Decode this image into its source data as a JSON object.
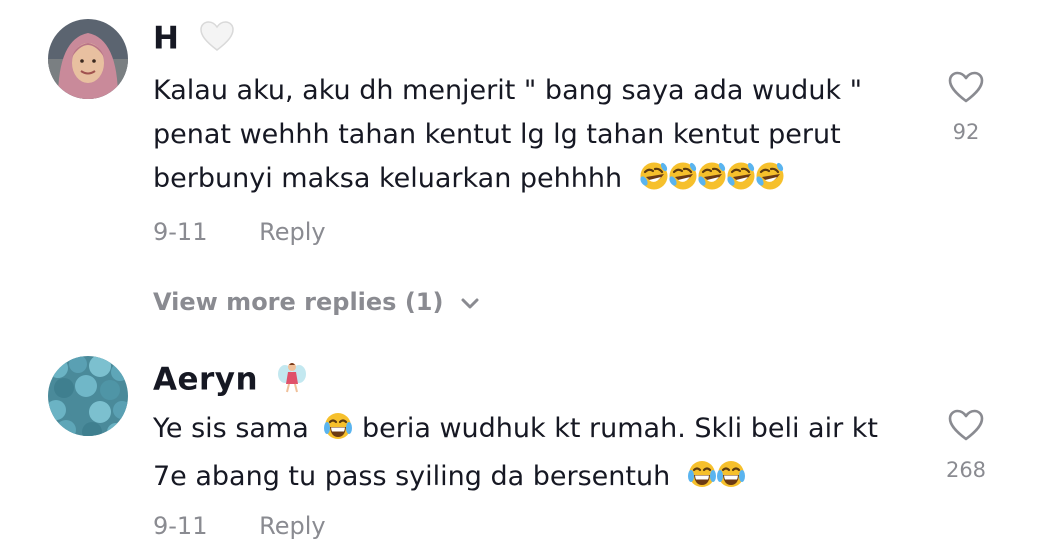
{
  "comments": [
    {
      "username": "H",
      "username_emoji": "white-heart-icon",
      "text_lines": [
        "Kalau aku, aku dh menjerit \" bang saya ada wuduk \"",
        "penat wehhh tahan kentut lg lg tahan kentut perut",
        "berbunyi maksa keluarkan pehhhh"
      ],
      "date": "9-11",
      "reply_label": "Reply",
      "like_count": "92",
      "view_more_label": "View more replies (1)"
    },
    {
      "username": "Aeryn",
      "username_emoji": "fairy-icon",
      "text_lines": [
        "Ye sis sama",
        "beria wudhuk kt rumah. Skli beli air kt",
        "7e abang tu pass syiling da bersentuh"
      ],
      "date": "9-11",
      "reply_label": "Reply",
      "like_count": "268"
    }
  ],
  "icons": {
    "heart_outline": "heart-outline-icon",
    "rofl": "rolling-on-floor-laughing-icon",
    "tears_of_joy": "face-with-tears-of-joy-icon",
    "chevron": "chevron-down-icon"
  },
  "colors": {
    "primary_text": "#161823",
    "secondary_text": "#8a8b91",
    "emoji_yellow": "#f6c02c"
  }
}
